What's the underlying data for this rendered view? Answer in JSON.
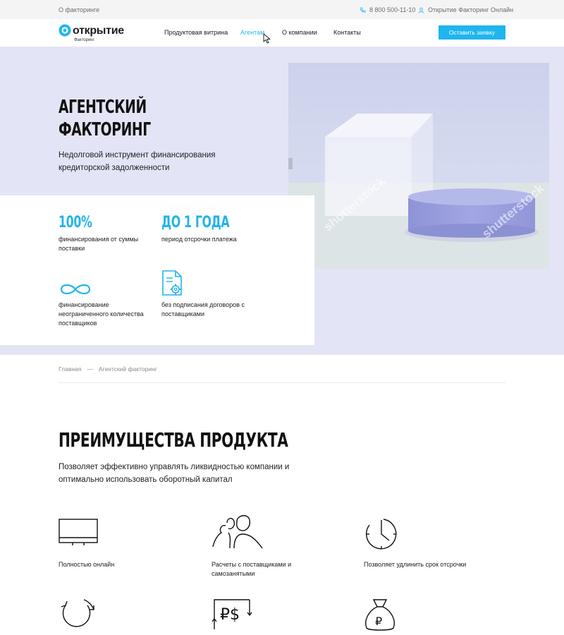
{
  "topbar": {
    "about": "О факторинге",
    "phone": "8 800 500-11-10",
    "online": "Открытие Факторинг Онлайн"
  },
  "header": {
    "logo_word": "открытие",
    "logo_sub": "Факторинг",
    "nav": [
      {
        "label": "Продуктовая витрина"
      },
      {
        "label": "Агентам",
        "active": true
      },
      {
        "label": "О компании"
      },
      {
        "label": "Контакты"
      }
    ],
    "cta_label": "Оставить заявку"
  },
  "hero": {
    "title_line1": "Агентский",
    "title_line2": "факторинг",
    "subtitle": "Недолговой инструмент финансирования кредиторской задолженности",
    "watermark": "shutterstock"
  },
  "stats": [
    {
      "value": "100%",
      "desc": "финансирования от суммы поставки"
    },
    {
      "value": "до 1 года",
      "desc": "период отсрочки платежа"
    },
    {
      "icon": "infinity-icon",
      "desc": "финансирование неограниченного количества поставщиков"
    },
    {
      "icon": "document-gear-icon",
      "desc": "без подписания договоров с поставщиками"
    }
  ],
  "breadcrumbs": {
    "home": "Главная",
    "separator": "—",
    "current": "Агентский факторинг"
  },
  "advantages": {
    "title": "Преимущества продукта",
    "subtitle": "Позволяет эффективно управлять ликвидностью компании и оптимально использовать оборотный капитал",
    "items": [
      {
        "icon": "monitor-icon",
        "label": "Полностью онлайн"
      },
      {
        "icon": "people-icon",
        "label": "Расчеты с поставщиками и самозанятыми"
      },
      {
        "icon": "clock-icon",
        "label": "Позволяет удлинить срок отсрочки"
      },
      {
        "icon": "refresh-icon",
        "label": ""
      },
      {
        "icon": "currency-exchange-icon",
        "label": ""
      },
      {
        "icon": "money-bag-icon",
        "label": ""
      }
    ]
  },
  "colors": {
    "accent": "#1fb5ef",
    "hero_bg": "#e3e5f6",
    "text": "#111111"
  }
}
